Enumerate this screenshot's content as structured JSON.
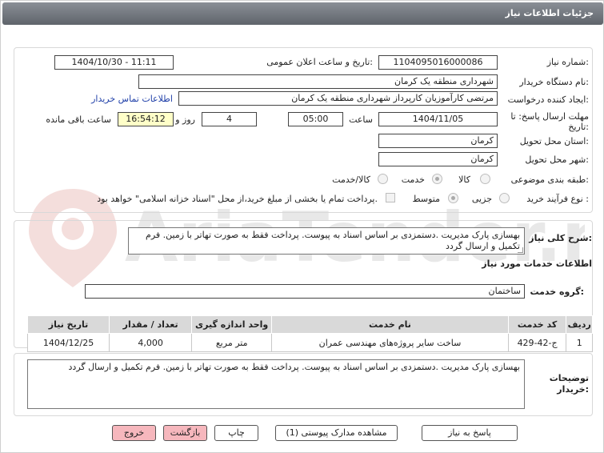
{
  "page": {
    "title": "جزئیات اطلاعات نیاز"
  },
  "info": {
    "need_number_label": "شماره نیاز:",
    "need_number": "1104095016000086",
    "announce_label": "تاریخ و ساعت اعلان عمومی:",
    "announce_value": "1404/10/30 - 11:11",
    "buyer_org_label": "نام دستگاه خریدار:",
    "buyer_org": "شهرداری منطقه یک کرمان",
    "creator_label": "ایجاد کننده درخواست:",
    "creator": "مرتضی کارآموزیان کارپرداز شهرداری منطقه یک کرمان",
    "contact_link": "اطلاعات تماس خریدار",
    "deadline_label_1": "مهلت ارسال پاسخ: تا",
    "deadline_label_2": "تاریخ:",
    "deadline_date": "1404/11/05",
    "time_label": "ساعت",
    "deadline_time": "05:00",
    "days": "4",
    "days_label": "روز و",
    "remaining_time": "16:54:12",
    "remaining_label": "ساعت باقی مانده",
    "province_label": "استان محل تحویل:",
    "province": "کرمان",
    "city_label": "شهر محل تحویل:",
    "city": "کرمان",
    "category_label": "طبقه بندی موضوعی:",
    "category_options": [
      "کالا",
      "خدمت",
      "کالا/خدمت"
    ],
    "category_selected": "خدمت",
    "process_label": "نوع فرآیند خرید :",
    "process_options": [
      "جزیی",
      "متوسط"
    ],
    "process_selected": "متوسط",
    "treasury_note": "پرداخت تمام یا بخشی از مبلغ خرید،از محل \"اسناد خزانه اسلامی\" خواهد بود."
  },
  "summary": {
    "label": "شرح کلی نیاز:",
    "text": "بهسازی پارک مدیریت .دستمزدی بر اساس اسناد به پیوست. پرداخت فقط به صورت تهاتر با زمین. فرم تکمیل و ارسال گردد"
  },
  "services": {
    "section_title": "اطلاعات خدمات مورد نیاز",
    "group_label": "گروه خدمت:",
    "group_value": "ساختمان",
    "columns": [
      "ردیف",
      "کد خدمت",
      "نام خدمت",
      "واحد اندازه گیری",
      "تعداد / مقدار",
      "تاریخ نیاز"
    ],
    "rows": [
      [
        "1",
        "ج-42-429",
        "ساخت سایر پروژه‌های مهندسی عمران",
        "متر مربع",
        "4,000",
        "1404/12/25"
      ]
    ]
  },
  "buyer_notes": {
    "label_1": "توضیحات",
    "label_2": "خریدار:",
    "text": "بهسازی پارک مدیریت .دستمزدی بر اساس اسناد به پیوست. پرداخت فقط به صورت تهاتر با زمین. فرم تکمیل و ارسال گردد"
  },
  "buttons": {
    "reply": "پاسخ به نیاز",
    "attachments": "مشاهده مدارک پیوستی (1)",
    "print": "چاپ",
    "back": "بازگشت",
    "exit": "خروج"
  },
  "watermark": {
    "text": "AriaTender.net"
  },
  "colors": {
    "title_bar": "#6f747b",
    "link": "#1f3fa8",
    "remaining_bg": "#ffffc8",
    "pink_button": "#f6b7bd"
  }
}
